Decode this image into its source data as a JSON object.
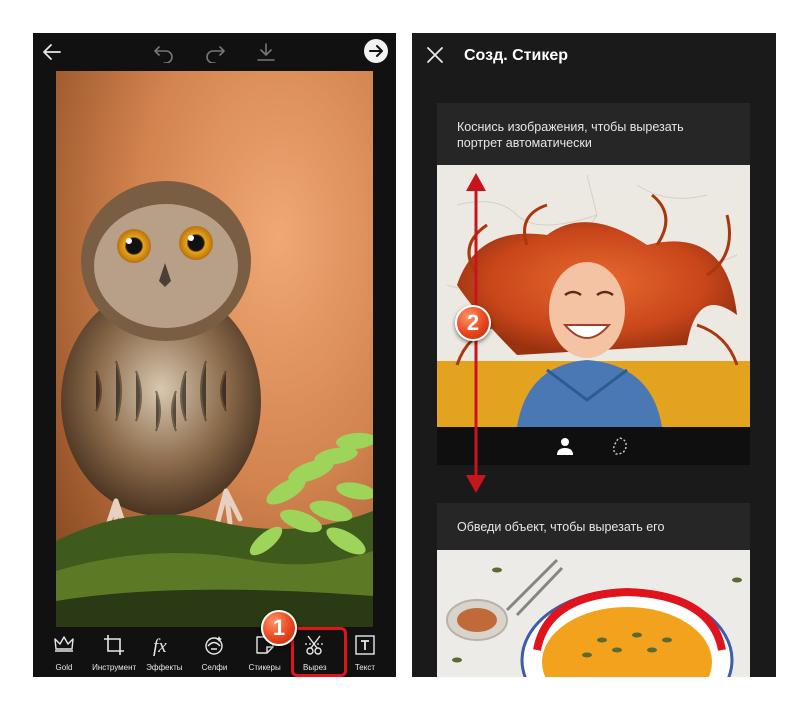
{
  "left_screen": {
    "toolbar": {
      "back": "back-arrow-icon",
      "undo": "undo-icon",
      "redo": "redo-icon",
      "download": "download-icon",
      "next": "next-arrow-icon"
    },
    "tools": [
      {
        "label": "Gold",
        "icon": "crown-icon"
      },
      {
        "label": "Инструмент",
        "icon": "crop-icon"
      },
      {
        "label": "Эффекты",
        "icon": "fx-icon"
      },
      {
        "label": "Селфи",
        "icon": "selfie-icon"
      },
      {
        "label": "Стикеры",
        "icon": "sticker-icon"
      },
      {
        "label": "Вырез",
        "icon": "cutout-icon"
      },
      {
        "label": "Текст",
        "icon": "text-icon"
      }
    ],
    "step_badge": "1"
  },
  "right_screen": {
    "title": "Созд. Стикер",
    "close": "close-icon",
    "cards": [
      {
        "text": "Коснись изображения, чтобы вырезать портрет автоматически"
      },
      {
        "text": "Обведи объект, чтобы вырезать его"
      }
    ],
    "modes": [
      "person-icon",
      "lasso-icon"
    ],
    "step_badge": "2"
  },
  "colors": {
    "accent": "#e0141c",
    "badge": "#e8461e",
    "dark_bg": "#111111"
  }
}
